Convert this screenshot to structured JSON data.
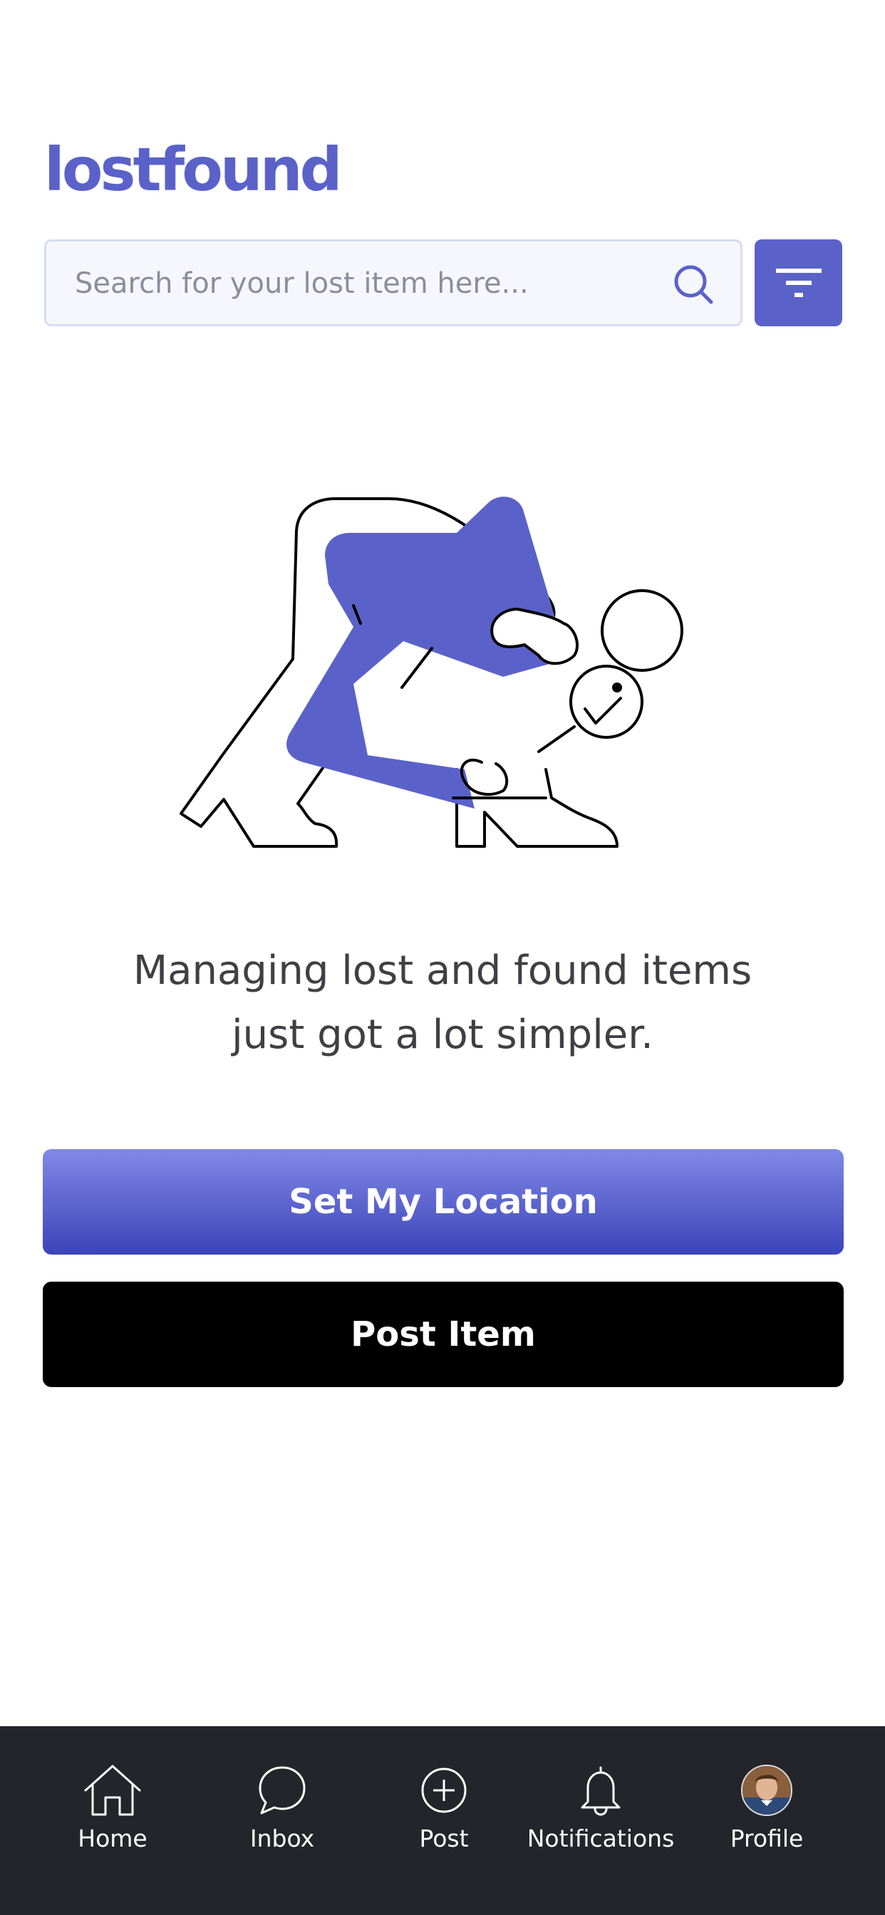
{
  "header": {
    "logo": "lostfound"
  },
  "search": {
    "placeholder": "Search for your lost item here..."
  },
  "hero": {
    "line1": "Managing lost and found items",
    "line2": "just got a lot simpler."
  },
  "actions": {
    "set_location": "Set My Location",
    "post_item": "Post Item"
  },
  "tabs": [
    {
      "label": "Home",
      "icon": "home-icon"
    },
    {
      "label": "Inbox",
      "icon": "chat-bubble-icon"
    },
    {
      "label": "Post",
      "icon": "plus-circle-icon"
    },
    {
      "label": "Notifications",
      "icon": "bell-icon"
    },
    {
      "label": "Profile",
      "icon": "avatar"
    }
  ],
  "colors": {
    "brand": "#5a62c9",
    "button_gradient_top": "#8189e6",
    "button_gradient_bottom": "#3b44b9",
    "tabbar": "#24252a"
  }
}
